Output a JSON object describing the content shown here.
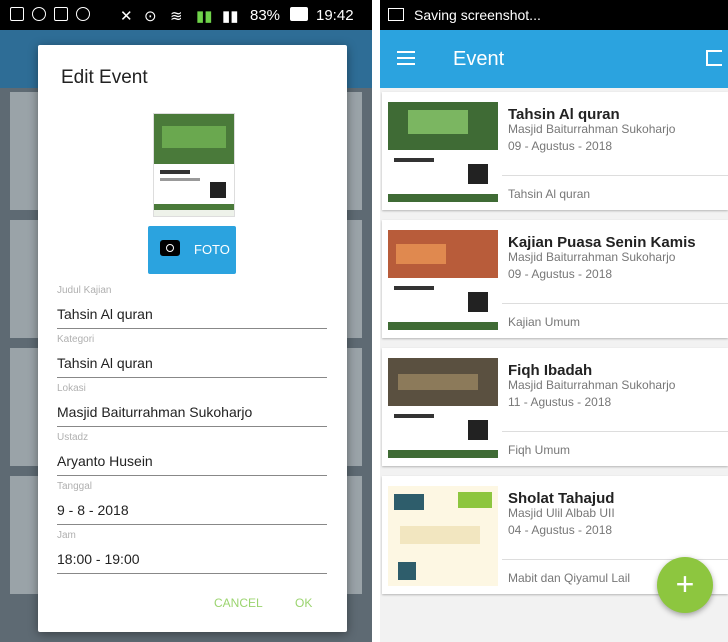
{
  "left_status": {
    "battery": "83%",
    "time": "19:42"
  },
  "dialog": {
    "title": "Edit Event",
    "foto_label": "FOTO",
    "fields": [
      {
        "label": "Judul Kajian",
        "value": "Tahsin Al quran"
      },
      {
        "label": "Kategori",
        "value": "Tahsin Al quran"
      },
      {
        "label": "Lokasi",
        "value": "Masjid Baiturrahman Sukoharjo"
      },
      {
        "label": "Ustadz",
        "value": "Aryanto Husein"
      },
      {
        "label": "Tanggal",
        "value": "9 - 8 - 2018"
      },
      {
        "label": "Jam",
        "value": "18:00 - 19:00"
      }
    ],
    "cancel_label": "CANCEL",
    "ok_label": "OK"
  },
  "right_status": {
    "text": "Saving screenshot..."
  },
  "appbar": {
    "title": "Event"
  },
  "events": [
    {
      "title": "Tahsin Al quran",
      "place": "Masjid Baiturrahman Sukoharjo",
      "date": "09 - Agustus - 2018",
      "category": "Tahsin Al quran"
    },
    {
      "title": "Kajian Puasa Senin Kamis",
      "place": "Masjid Baiturrahman Sukoharjo",
      "date": "09 - Agustus - 2018",
      "category": "Kajian Umum"
    },
    {
      "title": "Fiqh Ibadah",
      "place": "Masjid Baiturrahman Sukoharjo",
      "date": "11 - Agustus - 2018",
      "category": "Fiqh Umum"
    },
    {
      "title": "Sholat Tahajud",
      "place": "Masjid Ulil Albab UII",
      "date": "04 - Agustus - 2018",
      "category": "Mabit dan Qiyamul Lail"
    }
  ],
  "fab_label": "+",
  "colors": {
    "primary": "#2ba3df",
    "accent": "#8dc63f"
  }
}
